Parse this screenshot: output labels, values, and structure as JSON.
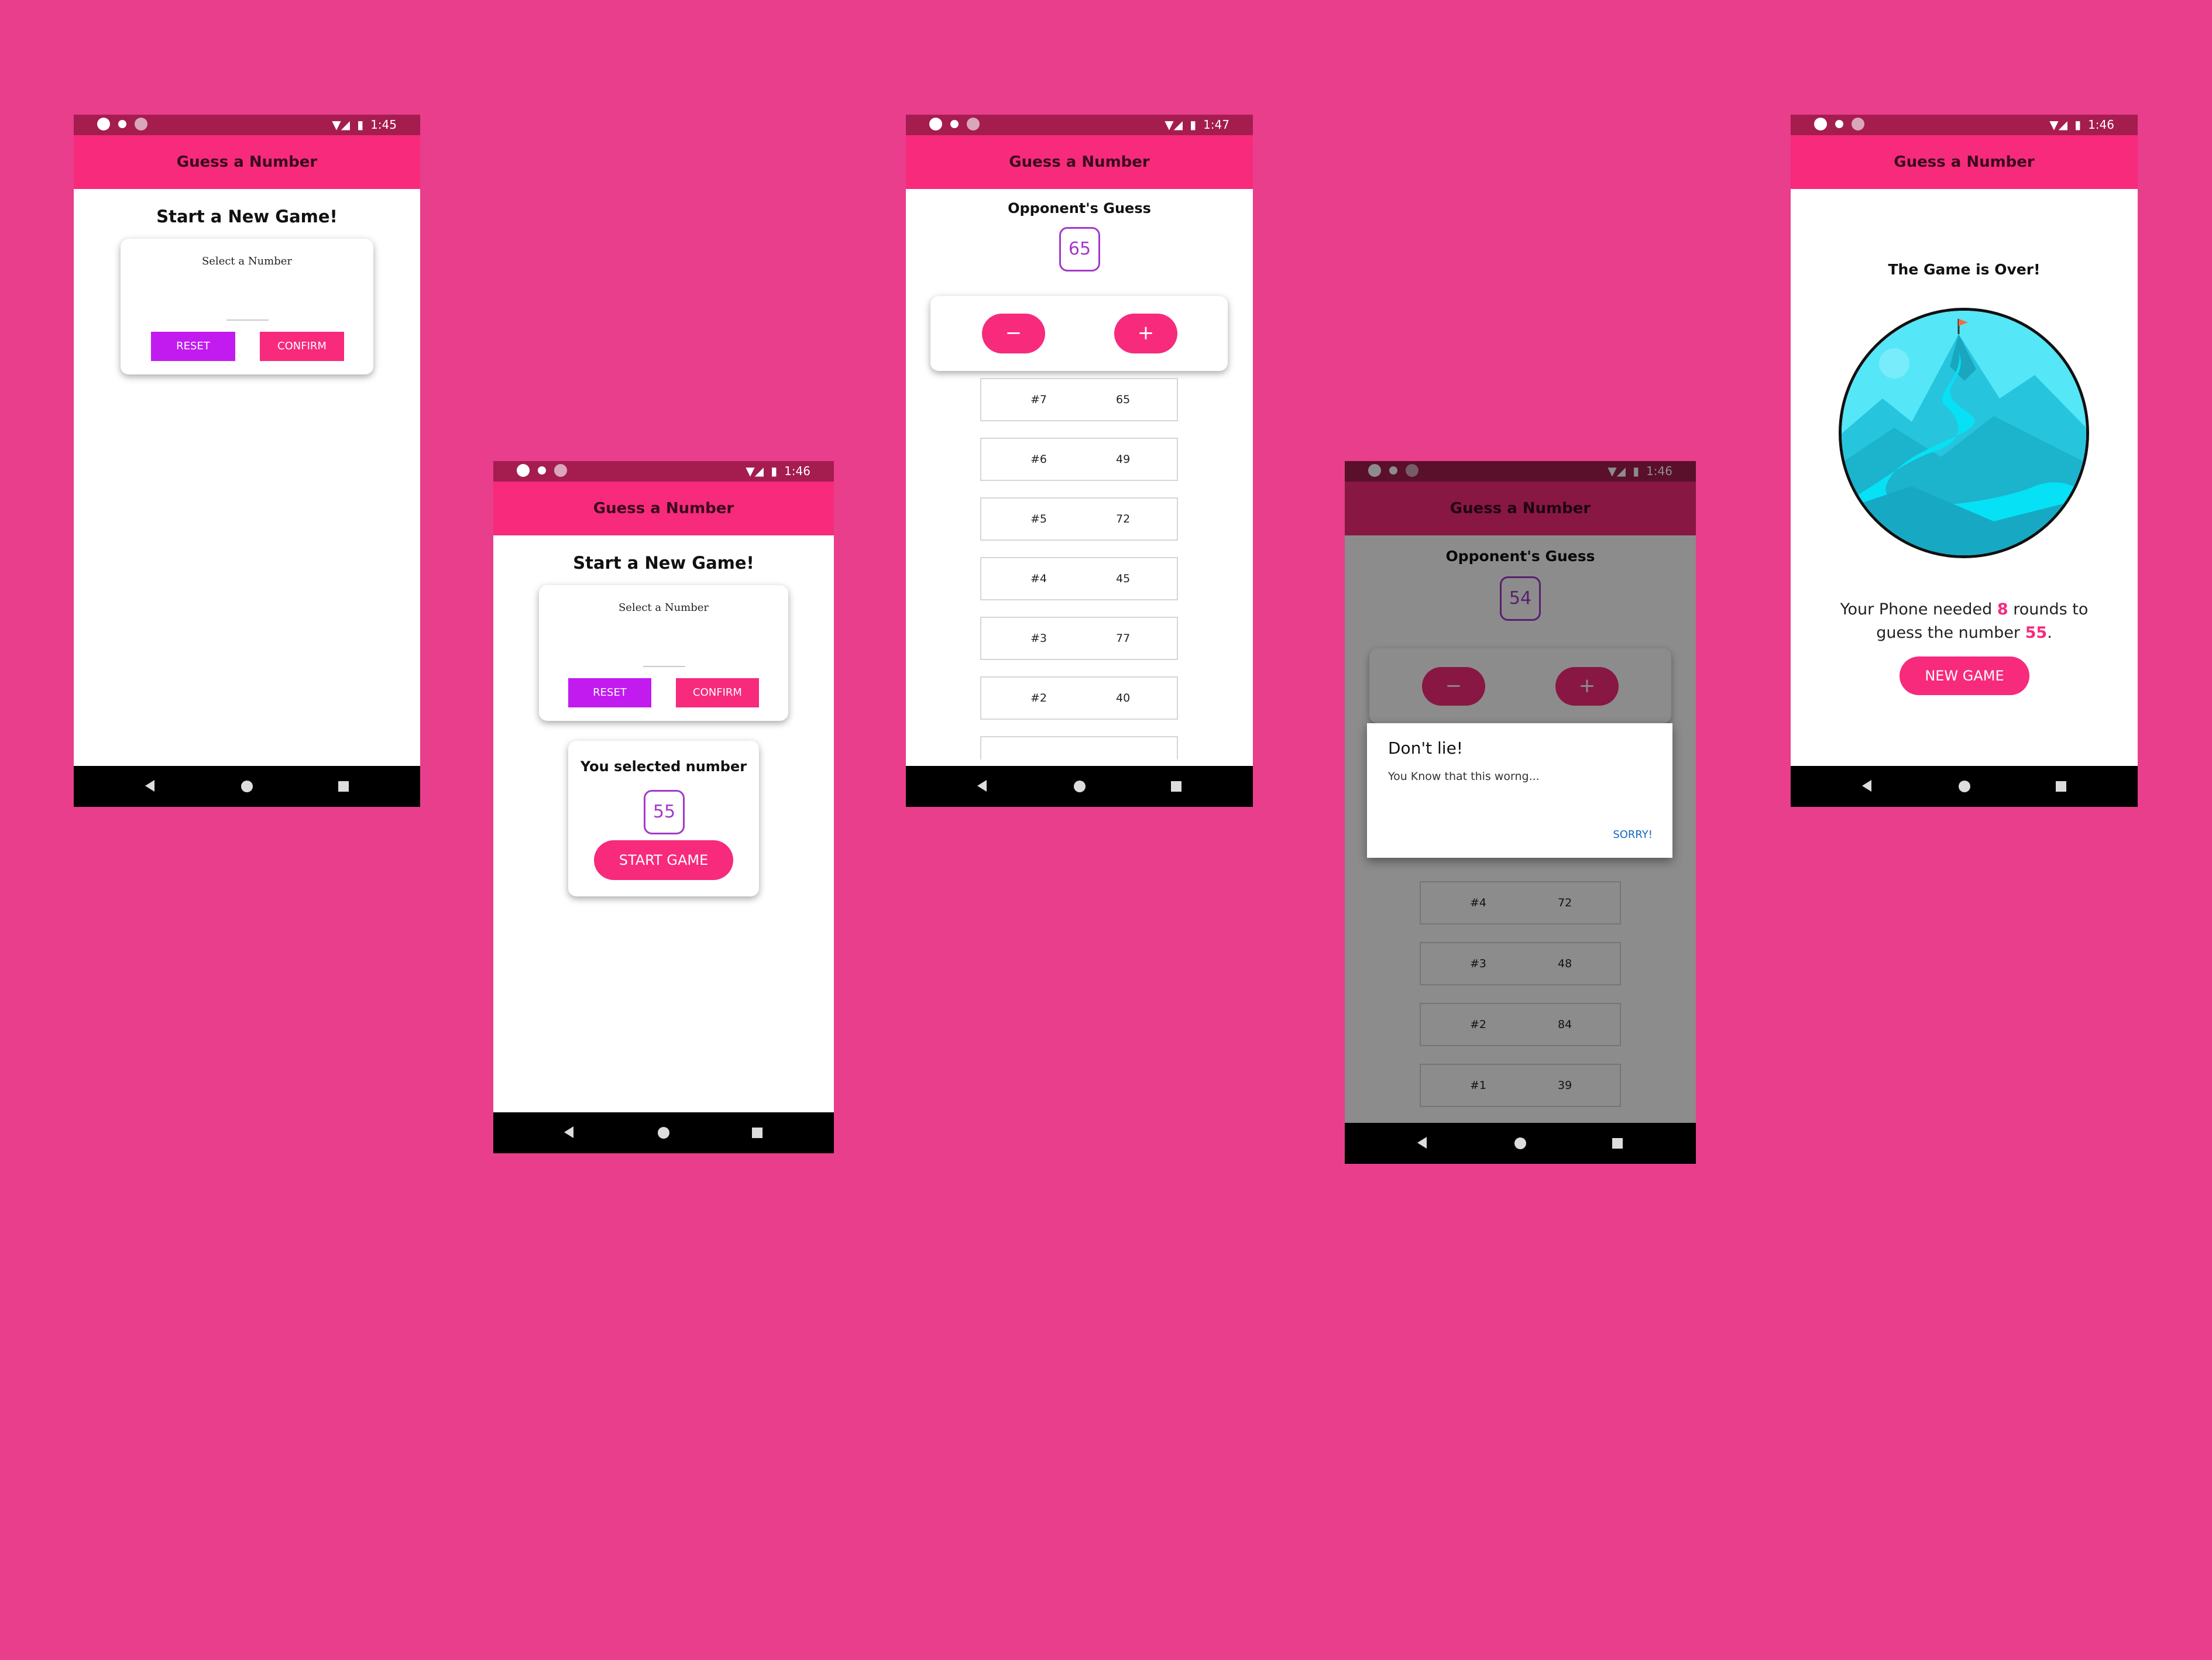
{
  "app_title": "Guess a Number",
  "colors": {
    "background": "#e83e8c",
    "primary": "#f72a7c",
    "accent": "#c21bf0",
    "status_bar": "#a51c4f"
  },
  "screens": {
    "s1": {
      "time": "1:45",
      "heading": "Start a New Game!",
      "select_label": "Select a Number",
      "reset": "RESET",
      "confirm": "CONFIRM"
    },
    "s2": {
      "time": "1:46",
      "heading": "Start a New Game!",
      "select_label": "Select a Number",
      "reset": "RESET",
      "confirm": "CONFIRM",
      "selected_title": "You selected number",
      "selected_value": "55",
      "start_button": "START GAME"
    },
    "s3": {
      "time": "1:47",
      "heading": "Opponent's Guess",
      "guess_value": "65",
      "minus": "−",
      "plus": "+",
      "rounds": [
        {
          "num": "#7",
          "value": "65"
        },
        {
          "num": "#6",
          "value": "49"
        },
        {
          "num": "#5",
          "value": "72"
        },
        {
          "num": "#4",
          "value": "45"
        },
        {
          "num": "#3",
          "value": "77"
        },
        {
          "num": "#2",
          "value": "40"
        }
      ]
    },
    "s4": {
      "time": "1:46",
      "heading": "Opponent's Guess",
      "guess_value": "54",
      "minus": "−",
      "plus": "+",
      "dialog": {
        "title": "Don't lie!",
        "message": "You Know that this worng...",
        "action": "SORRY!"
      },
      "rounds": [
        {
          "num": "#4",
          "value": "72"
        },
        {
          "num": "#3",
          "value": "48"
        },
        {
          "num": "#2",
          "value": "84"
        },
        {
          "num": "#1",
          "value": "39"
        }
      ]
    },
    "s5": {
      "time": "1:46",
      "heading": "The Game is Over!",
      "summary_a": "Your Phone needed ",
      "rounds_count": "8",
      "summary_b": " rounds to",
      "summary_c": "guess the number ",
      "number": "55",
      "summary_d": ".",
      "new_game": "NEW GAME"
    }
  }
}
